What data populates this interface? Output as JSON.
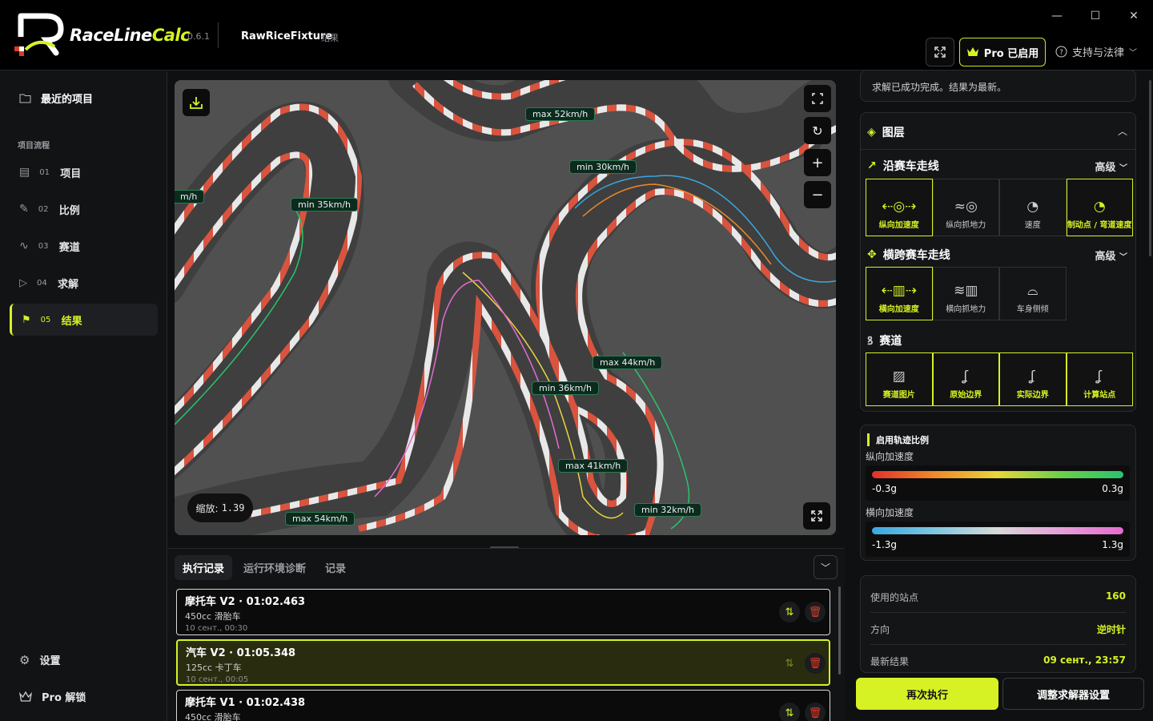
{
  "app": {
    "brand_a": "RaceLine",
    "brand_b": "Calc",
    "version": "0.6.1",
    "project": "RawRiceFixture",
    "project_sub": "结果"
  },
  "titlebar": {
    "pro_label": "Pro 已启用",
    "support_label": "支持与法律"
  },
  "sidebar": {
    "recent": "最近的项目",
    "caption": "项目流程",
    "items": [
      {
        "num": "01",
        "label": "项目"
      },
      {
        "num": "02",
        "label": "比例"
      },
      {
        "num": "03",
        "label": "赛道"
      },
      {
        "num": "04",
        "label": "求解"
      },
      {
        "num": "05",
        "label": "结果"
      }
    ],
    "settings": "设置",
    "pro_unlock": "Pro 解锁"
  },
  "map": {
    "zoom_label": "缩放:",
    "zoom_value": "1.39",
    "labels": [
      "max 52km/h",
      "min 30km/h",
      "min 35km/h",
      "max 44km/h",
      "min 36km/h",
      "max 41km/h",
      "min 32km/h",
      "max 54km/h",
      "m/h"
    ]
  },
  "log": {
    "tabs": [
      "执行记录",
      "运行环境诊断",
      "记录"
    ],
    "runs": [
      {
        "title": "摩托车 V2 · 01:02.463",
        "sub": "450cc 滑胎车",
        "time": "10 сент., 00:30"
      },
      {
        "title": "汽车 V2 · 01:05.348",
        "sub": "125cc 卡丁车",
        "time": "10 сент., 00:05"
      },
      {
        "title": "摩托车 V1 · 01:02.438",
        "sub": "450cc 滑胎车",
        "time": ""
      }
    ]
  },
  "right": {
    "status": "求解已成功完成。结果为最新。",
    "layers_title": "图层",
    "along_title": "沿赛车走线",
    "along_adv": "高级",
    "along_tiles": [
      "纵向加速度",
      "纵向抓地力",
      "速度",
      "制动点 / 弯道速度"
    ],
    "cross_title": "横跨赛车走线",
    "cross_adv": "高级",
    "cross_tiles": [
      "横向加速度",
      "横向抓地力",
      "车身侧倾"
    ],
    "track_title": "赛道",
    "track_tiles": [
      "赛道图片",
      "原始边界",
      "实际边界",
      "计算站点"
    ],
    "legend_title": "启用轨迹比例",
    "long_label": "纵向加速度",
    "long_min": "-0.3g",
    "long_max": "0.3g",
    "lat_label": "横向加速度",
    "lat_min": "-1.3g",
    "lat_max": "1.3g",
    "stats": [
      {
        "k": "使用的站点",
        "v": "160"
      },
      {
        "k": "方向",
        "v": "逆时针"
      },
      {
        "k": "最新结果",
        "v": "09 сент., 23:57"
      }
    ],
    "run_again": "再次执行",
    "adjust": "调整求解器设置"
  }
}
